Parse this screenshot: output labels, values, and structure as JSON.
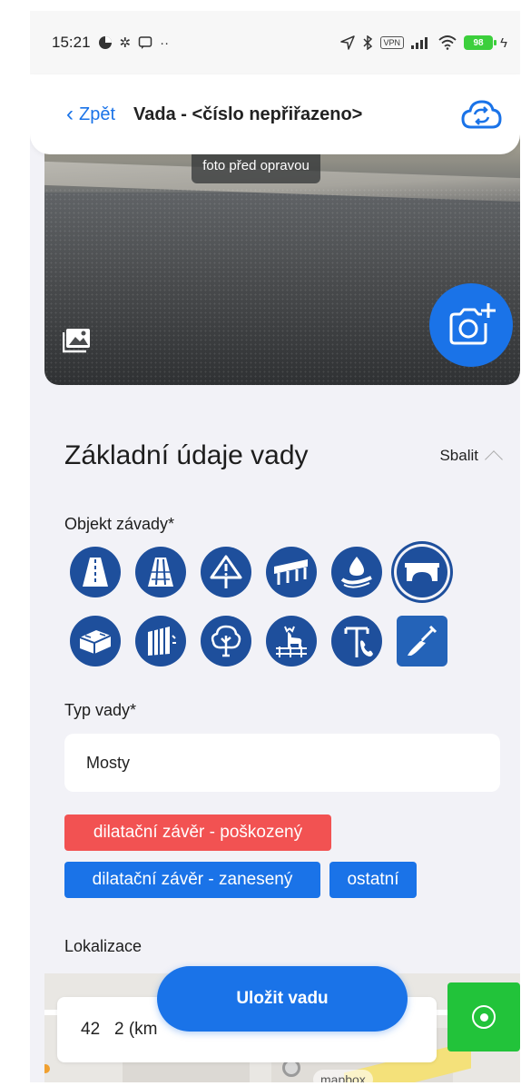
{
  "status_bar": {
    "time": "15:21",
    "vpn": "VPN",
    "battery": "98"
  },
  "nav": {
    "back_label": "Zpět",
    "title": "Vada - <číslo nepřiřazeno>"
  },
  "photo": {
    "caption": "foto před opravou"
  },
  "section": {
    "title": "Základní údaje vady",
    "collapse_label": "Sbalit"
  },
  "objekt": {
    "label": "Objekt závady*",
    "icons": [
      {
        "name": "road-icon",
        "selected": false
      },
      {
        "name": "road-lanes-icon",
        "selected": false
      },
      {
        "name": "traffic-sign-icon",
        "selected": false
      },
      {
        "name": "guardrail-icon",
        "selected": false
      },
      {
        "name": "drainage-icon",
        "selected": false
      },
      {
        "name": "bridge-icon",
        "selected": true
      },
      {
        "name": "wall-icon",
        "selected": false
      },
      {
        "name": "noise-barrier-icon",
        "selected": false
      },
      {
        "name": "tree-icon",
        "selected": false
      },
      {
        "name": "wildlife-fence-icon",
        "selected": false
      },
      {
        "name": "emergency-phone-icon",
        "selected": false
      },
      {
        "name": "shovel-icon",
        "selected": false
      }
    ]
  },
  "typ": {
    "label": "Typ vady*",
    "value": "Mosty"
  },
  "chips": [
    {
      "label": "dilatační závěr - poškozený",
      "color": "#f25252"
    },
    {
      "label": "dilatační závěr - zanesený",
      "color": "#1a73e8"
    },
    {
      "label": "ostatní",
      "color": "#1a73e8"
    }
  ],
  "lokalizace": {
    "label": "Lokalizace",
    "coord_value": "42   2 (km"
  },
  "map": {
    "logo_text": "mapbox"
  },
  "save_button": {
    "label": "Uložit vadu"
  },
  "colors": {
    "accent": "#1a73e8",
    "icon_bg": "#1e4f9c",
    "danger": "#f25252",
    "locate": "#22c33a"
  }
}
